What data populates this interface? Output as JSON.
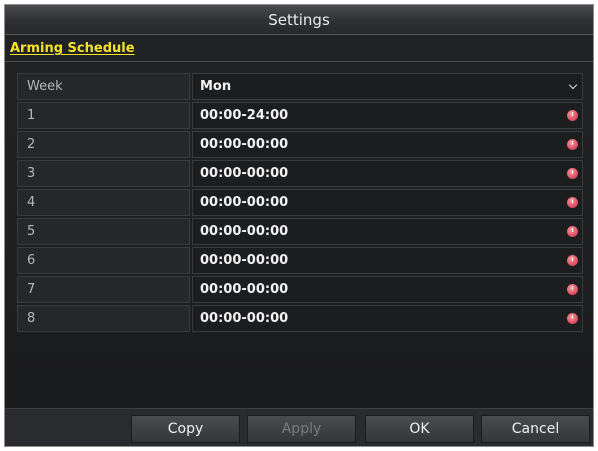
{
  "dialog": {
    "title": "Settings"
  },
  "tab": {
    "label": "Arming Schedule"
  },
  "schedule": {
    "week_label": "Week",
    "selected_day": "Mon",
    "rows": [
      {
        "index": "1",
        "time": "00:00-24:00"
      },
      {
        "index": "2",
        "time": "00:00-00:00"
      },
      {
        "index": "3",
        "time": "00:00-00:00"
      },
      {
        "index": "4",
        "time": "00:00-00:00"
      },
      {
        "index": "5",
        "time": "00:00-00:00"
      },
      {
        "index": "6",
        "time": "00:00-00:00"
      },
      {
        "index": "7",
        "time": "00:00-00:00"
      },
      {
        "index": "8",
        "time": "00:00-00:00"
      }
    ]
  },
  "buttons": {
    "copy": "Copy",
    "apply": "Apply",
    "ok": "OK",
    "cancel": "Cancel"
  },
  "colors": {
    "accent": "#f4e22a",
    "clock_icon": "#e0566b",
    "background": "#1c1d1f"
  },
  "icons": {
    "time_picker": "clock-icon",
    "dropdown": "chevron-down-icon"
  }
}
